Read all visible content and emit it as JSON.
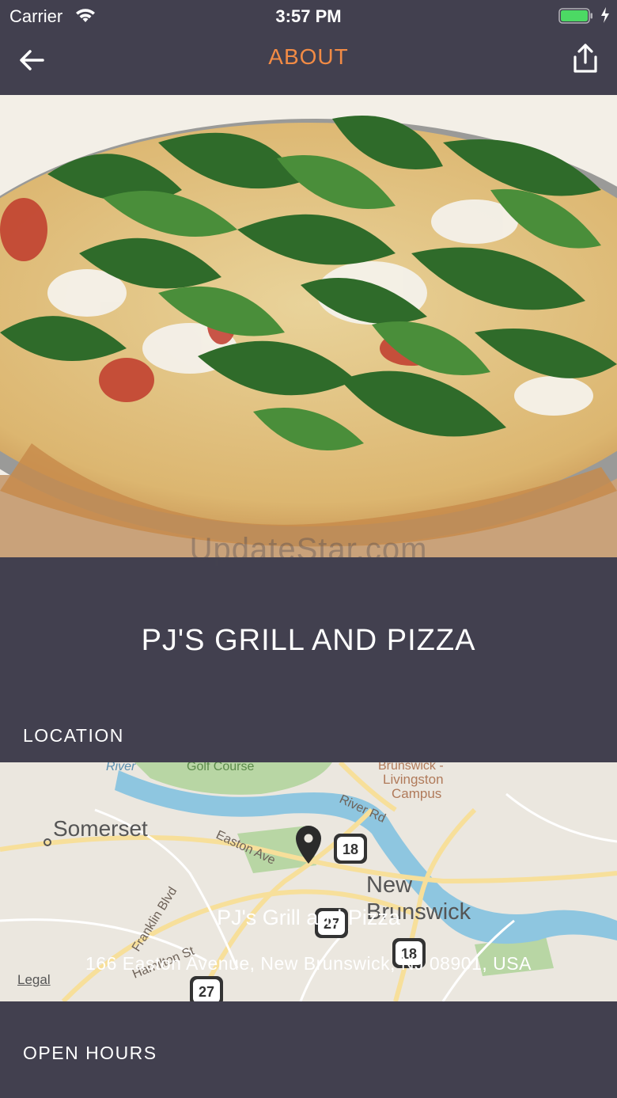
{
  "status": {
    "carrier": "Carrier",
    "time": "3:57 PM",
    "battery_color": "#4cd964"
  },
  "nav": {
    "title": "ABOUT",
    "title_color": "#f28b45",
    "back_icon": "arrow-left-icon",
    "share_icon": "share-icon"
  },
  "hero": {
    "watermark": "UpdateStar.com"
  },
  "restaurant": {
    "name": "PJ'S GRILL AND PIZZA"
  },
  "sections": {
    "location_label": "LOCATION",
    "open_hours_label": "OPEN HOURS"
  },
  "map": {
    "pin_title": "PJ's Grill and Pizza",
    "address": "166 Easton Avenue, New Brunswick, NJ 08901, USA",
    "legal": "Legal",
    "labels": {
      "somerset": "Somerset",
      "new": "New",
      "brunswick": "Brunswick",
      "river_rd": "River Rd",
      "easton_ave": "Easton Ave",
      "franklin_blvd": "Franklin Blvd",
      "hamilton_st": "Hamilton St",
      "campus_1": "Brunswick -",
      "campus_2": "Livingston",
      "campus_3": "Campus",
      "golf_course": "Golf Course",
      "river": "River",
      "route_18": "18",
      "route_27": "27"
    }
  }
}
